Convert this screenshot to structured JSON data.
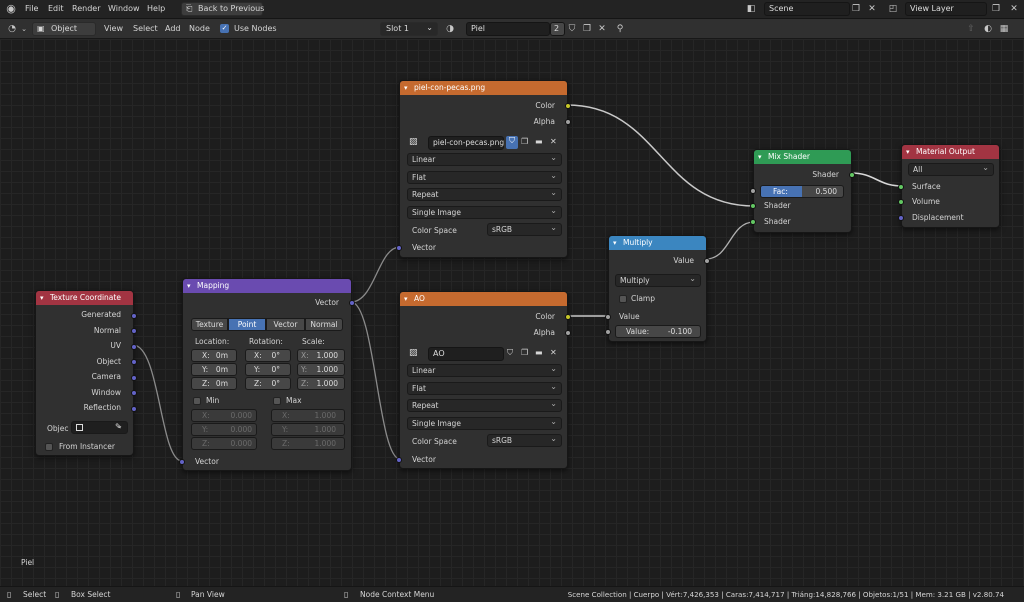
{
  "topbar": {
    "menus": [
      "File",
      "Edit",
      "Render",
      "Window",
      "Help"
    ],
    "back_button": "Back to Previous",
    "scene": "Scene",
    "view_layer": "View Layer"
  },
  "editor_header": {
    "mode": "Object",
    "menus": [
      "View",
      "Select",
      "Add",
      "Node"
    ],
    "use_nodes": "Use Nodes",
    "slot": "Slot 1",
    "material": "Piel",
    "users": "2"
  },
  "material_label": "Piel",
  "nodes": {
    "tex_coord": {
      "title": "Texture Coordinate",
      "outputs": [
        "Generated",
        "Normal",
        "UV",
        "Object",
        "Camera",
        "Window",
        "Reflection"
      ],
      "object_label": "Objec",
      "from_instancer": "From Instancer"
    },
    "mapping": {
      "title": "Mapping",
      "output": "Vector",
      "tabs": [
        "Texture",
        "Point",
        "Vector",
        "Normal"
      ],
      "active_tab": "Point",
      "col_labels": [
        "Location:",
        "Rotation:",
        "Scale:"
      ],
      "loc": [
        [
          "X:",
          "0m"
        ],
        [
          "Y:",
          "0m"
        ],
        [
          "Z:",
          "0m"
        ]
      ],
      "rot": [
        [
          "X:",
          "0°"
        ],
        [
          "Y:",
          "0°"
        ],
        [
          "Z:",
          "0°"
        ]
      ],
      "scale": [
        [
          "X:",
          "1.000"
        ],
        [
          "Y:",
          "1.000"
        ],
        [
          "Z:",
          "1.000"
        ]
      ],
      "min_label": "Min",
      "max_label": "Max",
      "min": [
        [
          "X:",
          "0.000"
        ],
        [
          "Y:",
          "0.000"
        ],
        [
          "Z:",
          "0.000"
        ]
      ],
      "max": [
        [
          "X:",
          "1.000"
        ],
        [
          "Y:",
          "1.000"
        ],
        [
          "Z:",
          "1.000"
        ]
      ],
      "input": "Vector"
    },
    "img1": {
      "title": "piel-con-pecas.png",
      "out_color": "Color",
      "out_alpha": "Alpha",
      "image": "piel-con-pecas.png",
      "interp": "Linear",
      "proj": "Flat",
      "ext": "Repeat",
      "source": "Single Image",
      "cs_label": "Color Space",
      "cs": "sRGB",
      "input": "Vector"
    },
    "img2": {
      "title": "AO",
      "out_color": "Color",
      "out_alpha": "Alpha",
      "image": "AO",
      "interp": "Linear",
      "proj": "Flat",
      "ext": "Repeat",
      "source": "Single Image",
      "cs_label": "Color Space",
      "cs": "sRGB",
      "input": "Vector"
    },
    "multiply": {
      "title": "Multiply",
      "output": "Value",
      "op": "Multiply",
      "clamp": "Clamp",
      "in_value": "Value",
      "value_label": "Value:",
      "value": "-0.100"
    },
    "mix": {
      "title": "Mix Shader",
      "output": "Shader",
      "fac_label": "Fac:",
      "fac": "0.500",
      "fac_fraction": 0.5,
      "shader1": "Shader",
      "shader2": "Shader"
    },
    "output": {
      "title": "Material Output",
      "target": "All",
      "surface": "Surface",
      "volume": "Volume",
      "displacement": "Displacement"
    }
  },
  "statusbar": {
    "select": "Select",
    "box_select": "Box Select",
    "pan": "Pan View",
    "context": "Node Context Menu",
    "stats": "Scene Collection | Cuerpo | Vért:7,426,353 | Caras:7,414,717 | Triáng:14,828,766 | Objetos:1/51 | Mem: 3.21 GB | v2.80.74"
  },
  "colors": {
    "input_header": "#a23442",
    "vector_header": "#6a4bb0",
    "texture_header": "#c56a2f",
    "converter_header": "#3b86c0",
    "shader_header": "#2f9b55",
    "output_header": "#a23442",
    "socket_vector": "#6363c7",
    "socket_color": "#c7c729",
    "socket_float": "#a1a1a1",
    "socket_shader": "#63c763"
  }
}
